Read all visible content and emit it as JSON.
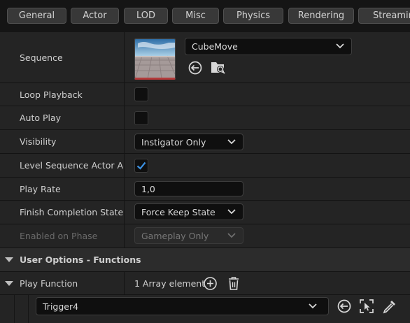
{
  "tabs": [
    "General",
    "Actor",
    "LOD",
    "Misc",
    "Physics",
    "Rendering",
    "Streamin"
  ],
  "properties": {
    "sequence": {
      "label": "Sequence",
      "value": "CubeMove"
    },
    "loop_playback": {
      "label": "Loop Playback",
      "checked": false
    },
    "auto_play": {
      "label": "Auto Play",
      "checked": false
    },
    "visibility": {
      "label": "Visibility",
      "value": "Instigator Only"
    },
    "level_sequence_actor": {
      "label": "Level Sequence Actor A...",
      "checked": true
    },
    "play_rate": {
      "label": "Play Rate",
      "value": "1,0"
    },
    "finish_completion": {
      "label": "Finish Completion State...",
      "value": "Force Keep State"
    },
    "enabled_on_phase": {
      "label": "Enabled on Phase",
      "value": "Gameplay Only",
      "enabled": false
    }
  },
  "sections": {
    "user_options_functions": "User Options - Functions"
  },
  "play_function": {
    "label": "Play Function",
    "summary": "1 Array element",
    "element_value": "Trigger4"
  },
  "colors": {
    "accent": "#3b8fe0",
    "panel": "#242424",
    "section": "#2c2c2c",
    "field": "#0f0f0f"
  }
}
